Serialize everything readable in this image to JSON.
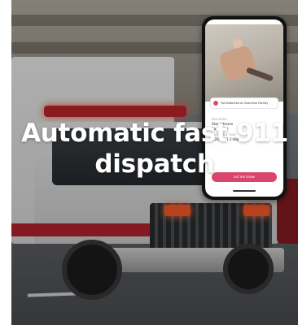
{
  "headline": {
    "line1": "Automatic fast 911",
    "line2": "dispatch"
  },
  "phone": {
    "alert_text": "Fall Detected at Shoreline Facility",
    "resident_label": "RESIDENT",
    "resident_name": "Stan Johnson",
    "location_label": "Room 124",
    "date_label": "DATE AND TIME",
    "date_value": "6/20/2022 2:48pm",
    "cta_label": "Let me know"
  },
  "colors": {
    "accent": "#d9456b",
    "headline": "#ffffff"
  },
  "icons": [
    "alert-dot-icon"
  ]
}
